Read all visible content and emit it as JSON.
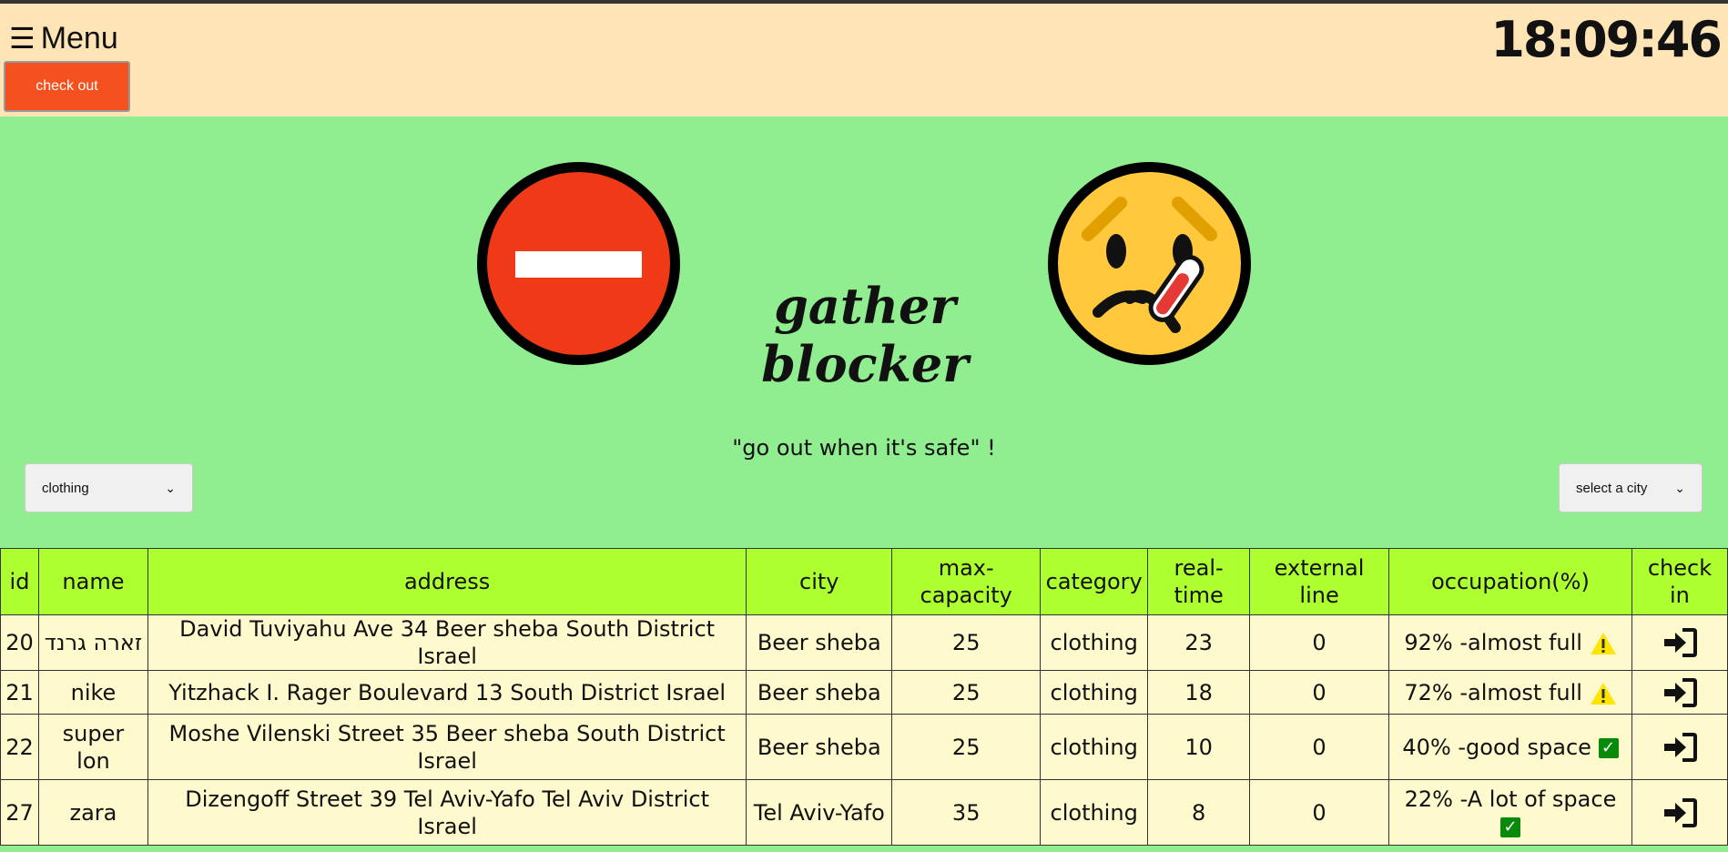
{
  "header": {
    "menu_label": "Menu",
    "checkout_label": "check out",
    "clock": "18:09:46"
  },
  "hero": {
    "title": "gather blocker",
    "slogan": "\"go out when it's safe\" !"
  },
  "filters": {
    "category_selected": "clothing",
    "city_placeholder": "select a city"
  },
  "table": {
    "headers": [
      "id",
      "name",
      "address",
      "city",
      "max-capacity",
      "category",
      "real-time",
      "external line",
      "occupation(%)",
      "check in"
    ],
    "rows": [
      {
        "id": "20",
        "name": "זארה גרנד",
        "address": "David Tuviyahu Ave 34 Beer sheba South District Israel",
        "city": "Beer sheba",
        "max_capacity": "25",
        "category": "clothing",
        "real_time": "23",
        "external_line": "0",
        "occupation": "92% -almost full",
        "status": "warning"
      },
      {
        "id": "21",
        "name": "nike",
        "address": "Yitzhack I. Rager Boulevard 13 South District Israel",
        "city": "Beer sheba",
        "max_capacity": "25",
        "category": "clothing",
        "real_time": "18",
        "external_line": "0",
        "occupation": "72% -almost full",
        "status": "warning"
      },
      {
        "id": "22",
        "name": "super lon",
        "address": "Moshe Vilenski Street 35 Beer sheba South District Israel",
        "city": "Beer sheba",
        "max_capacity": "25",
        "category": "clothing",
        "real_time": "10",
        "external_line": "0",
        "occupation": "40% -good space",
        "status": "ok"
      },
      {
        "id": "27",
        "name": "zara",
        "address": "Dizengoff Street 39 Tel Aviv-Yafo Tel Aviv District Israel",
        "city": "Tel Aviv-Yafo",
        "max_capacity": "35",
        "category": "clothing",
        "real_time": "8",
        "external_line": "0",
        "occupation": "22% -A lot of space",
        "status": "ok"
      }
    ]
  },
  "icons": {
    "menu": "hamburger-icon",
    "hero_left": "no-entry-icon",
    "hero_right": "sick-face-icon",
    "warning": "warning-icon",
    "ok": "check-mark-icon",
    "checkin": "sign-in-icon"
  },
  "colors": {
    "page_bg": "#90EE90",
    "header_bg": "#FFE4B5",
    "checkout_bg": "#F4511E",
    "table_header_bg": "#ADFF2F",
    "table_row_bg": "#FFFACD"
  }
}
